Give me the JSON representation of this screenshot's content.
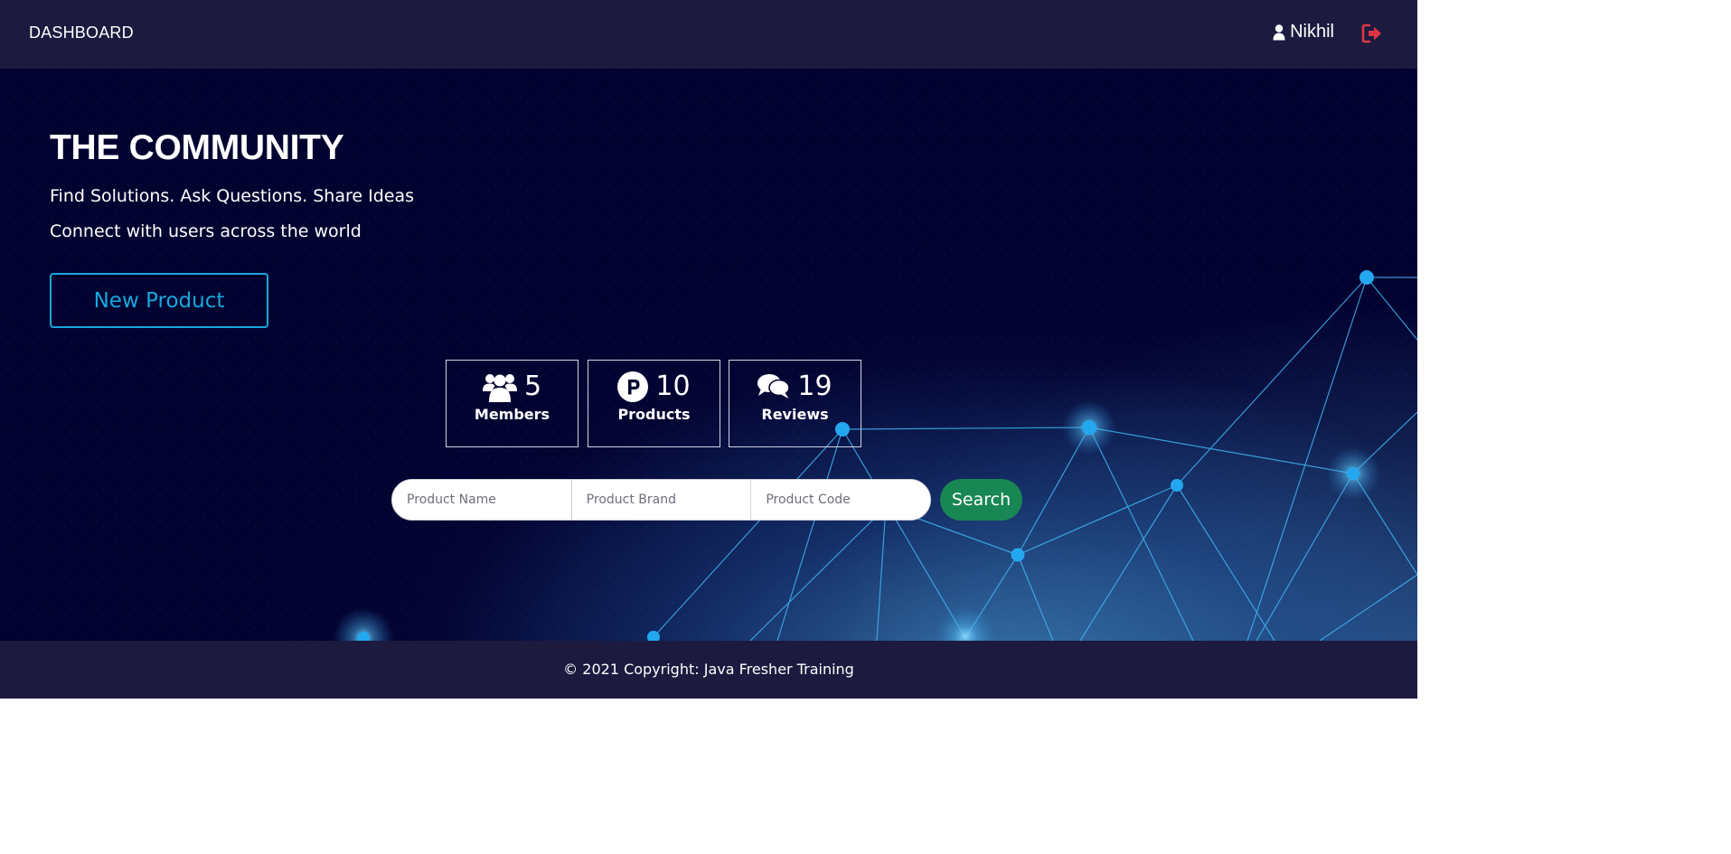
{
  "navbar": {
    "brand": "DASHBOARD",
    "user_name": "Nikhil",
    "user_icon": "user-icon",
    "logout_icon": "sign-out-icon",
    "logout_color": "#dc3545"
  },
  "hero": {
    "title": "THE COMMUNITY",
    "tagline_1": "Find Solutions. Ask Questions. Share Ideas",
    "tagline_2": "Connect with users across the world",
    "new_product_label": "New Product",
    "accent_color": "#19a7dc"
  },
  "stats": [
    {
      "icon": "users-icon",
      "count": "5",
      "label": "Members"
    },
    {
      "icon": "product-hunt-icon",
      "count": "10",
      "label": "Products"
    },
    {
      "icon": "comments-icon",
      "count": "19",
      "label": "Reviews"
    }
  ],
  "search": {
    "name_placeholder": "Product Name",
    "brand_placeholder": "Product Brand",
    "code_placeholder": "Product Code",
    "button_label": "Search",
    "button_color": "#198754"
  },
  "footer": {
    "text": "© 2021 Copyright: Java Fresher Training"
  },
  "colors": {
    "navbar_bg": "#1c1b3f",
    "hero_bg": "#020230",
    "network_node": "#23a8f0"
  }
}
